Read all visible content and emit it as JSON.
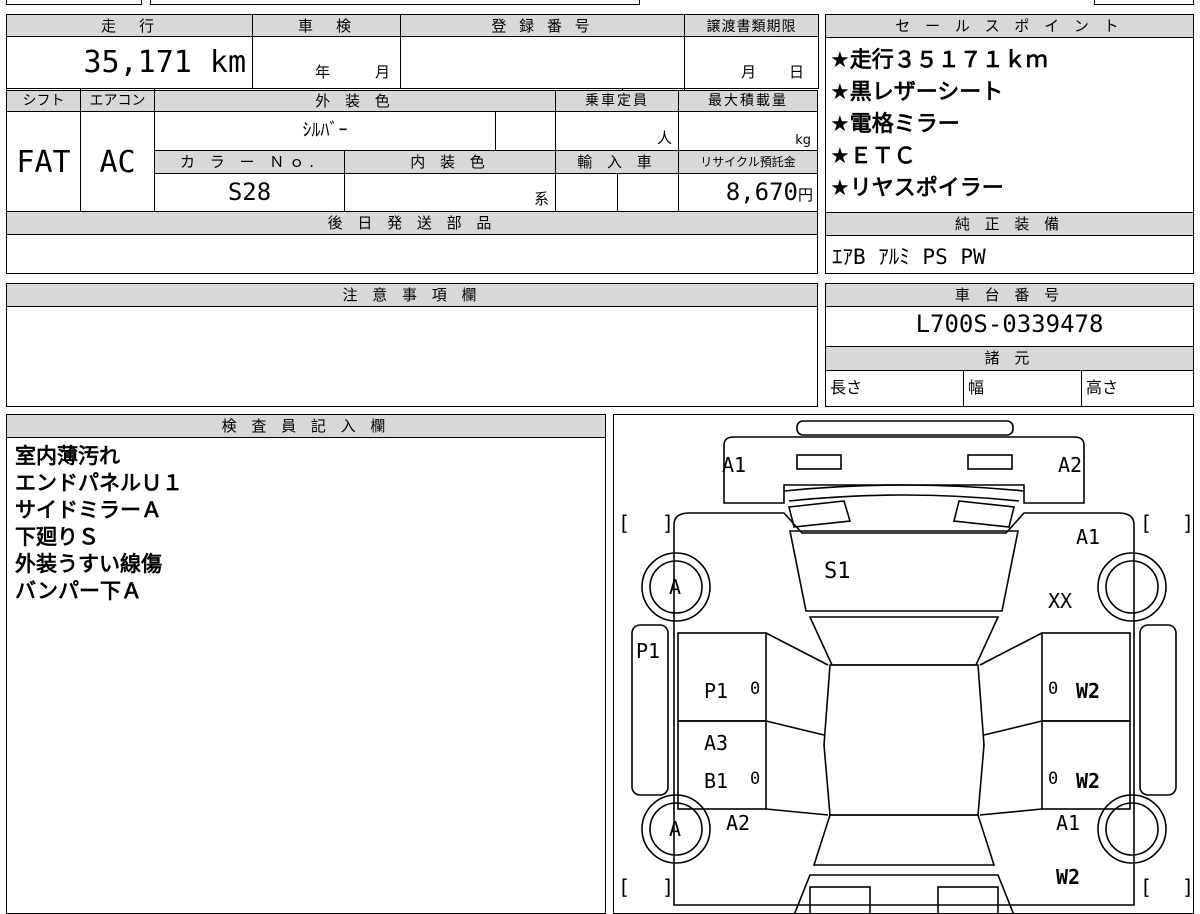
{
  "header": {
    "mileage_label": "走　行",
    "mileage_value": "35,171 km",
    "shaken_label": "車　検",
    "shaken_year": "年",
    "shaken_month": "月",
    "reg_label": "登 録 番 号",
    "reg_value": "",
    "transfer_label": "譲渡書類期限",
    "transfer_month": "月",
    "transfer_day": "日",
    "shift_label": "シフト",
    "shift_value": "FAT",
    "ac_label": "エアコン",
    "ac_value": "AC",
    "ext_color_label": "外 装 色",
    "ext_color_value": "ｼﾙﾊﾞｰ",
    "capacity_label": "乗車定員",
    "capacity_unit": "人",
    "load_label": "最大積載量",
    "load_unit": "kg",
    "color_no_label": "カ ラ ー Ｎｏ.",
    "color_no_value": "S28",
    "int_color_label": "内 装 色",
    "int_color_unit": "系",
    "import_label": "輸 入 車",
    "recycle_label": "リサイクル預託金",
    "recycle_value": "8,670",
    "recycle_unit": "円",
    "later_parts_label": "後 日 発 送 部 品"
  },
  "sales_points": {
    "label": "セ ー ル ス ポ イ ン ト",
    "items": [
      "★走行３５１７１ｋｍ",
      "★黒レザーシート",
      "★電格ミラー",
      "★ＥＴＣ",
      "★リヤスポイラー"
    ]
  },
  "equipment": {
    "label": "純 正 装 備",
    "value": "ｴｱB ｱﾙﾐ PS PW"
  },
  "notes": {
    "label": "注 意 事 項 欄"
  },
  "chassis": {
    "label": "車 台 番 号",
    "value": "L700S-0339478"
  },
  "specs": {
    "label": "諸 元",
    "length": "長さ",
    "width": "幅",
    "height": "高さ"
  },
  "inspector": {
    "label": "検 査 員 記 入 欄",
    "lines": [
      "室内薄汚れ",
      "エンドパネルＵ１",
      "サイドミラーＡ",
      "下廻りＳ",
      "外装うすい線傷",
      "バンパー下Ａ"
    ]
  },
  "diagram": {
    "marks": {
      "front_left": "A1",
      "front_right": "A2",
      "fender_right": "A1",
      "hood": "S1",
      "wheel_front_left": "A",
      "front_right_xx": "XX",
      "sill_left": "P1",
      "door_front_left": "P1",
      "door_front_left_zero": "0",
      "door_front_right_zero": "0",
      "door_front_right": "W2",
      "door_rear_left_a": "A3",
      "door_rear_left_b": "B1",
      "door_rear_left_zero": "0",
      "door_rear_right_zero": "0",
      "door_rear_right": "W2",
      "wheel_rear_left": "A",
      "rear_left": "A2",
      "rear_right": "A1",
      "rear_right_bottom": "W2",
      "bracket_open": "[",
      "bracket_close": "]"
    }
  }
}
